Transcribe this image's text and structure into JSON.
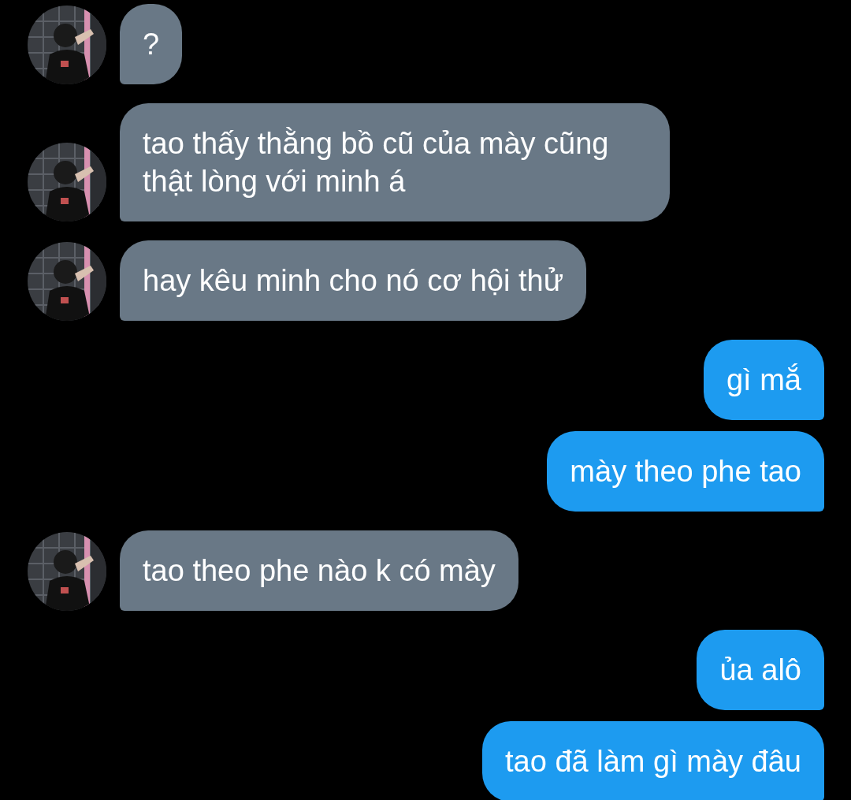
{
  "messages": [
    {
      "kind": "incoming",
      "text": "?"
    },
    {
      "kind": "incoming",
      "text": "tao thấy thằng bồ cũ của mày cũng thật lòng với minh á"
    },
    {
      "kind": "incoming",
      "text": "hay kêu minh cho nó cơ hội thử"
    },
    {
      "kind": "outgoing",
      "text": "gì mắ"
    },
    {
      "kind": "outgoing",
      "text": "mày theo phe tao"
    },
    {
      "kind": "incoming",
      "text": "tao theo phe nào k có mày"
    },
    {
      "kind": "outgoing",
      "text": "ủa alô"
    },
    {
      "kind": "outgoing",
      "text": "tao đã làm gì mày đâu"
    }
  ]
}
